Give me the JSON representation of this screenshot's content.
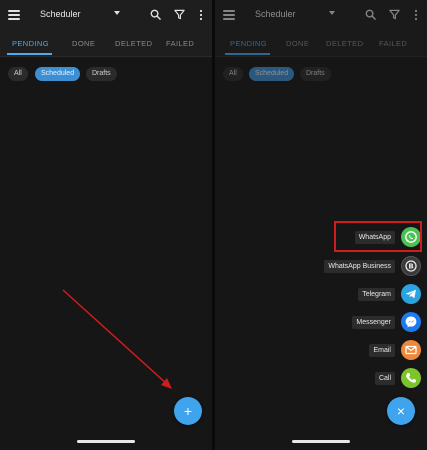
{
  "colors": {
    "accent": "#4ea9ee",
    "fab": "#3fa3ee",
    "highlight": "#d01c1c",
    "arrow": "#d01c1c",
    "whatsapp": "#4bc253",
    "whatsapp_business": "#3a3a3a",
    "telegram": "#2aa3de",
    "messenger": "#1d7af2",
    "email": "#f0883a",
    "call": "#7cc42b"
  },
  "left": {
    "app_title": "Scheduler",
    "tabs": [
      "PENDING",
      "DONE",
      "DELETED",
      "FAILED"
    ],
    "chips": [
      "All",
      "Scheduled",
      "Drafts"
    ],
    "fab_label": "+"
  },
  "right": {
    "app_title": "Scheduler",
    "tabs": [
      "PENDING",
      "DONE",
      "DELETED",
      "FAILED"
    ],
    "chips": [
      "All",
      "Scheduled",
      "Drafts"
    ],
    "fab_label": "×",
    "fab_options": [
      {
        "label": "WhatsApp",
        "icon": "whatsapp-icon"
      },
      {
        "label": "WhatsApp Business",
        "icon": "whatsapp-business-icon"
      },
      {
        "label": "Telegram",
        "icon": "telegram-icon"
      },
      {
        "label": "Messenger",
        "icon": "messenger-icon"
      },
      {
        "label": "Email",
        "icon": "email-icon"
      },
      {
        "label": "Call",
        "icon": "phone-icon"
      }
    ]
  }
}
